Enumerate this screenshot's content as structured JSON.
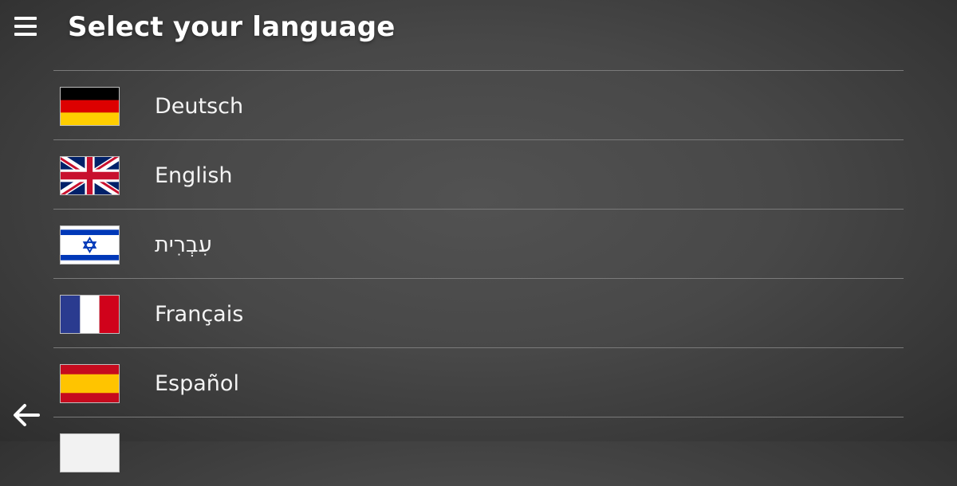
{
  "header": {
    "menu_icon": "hamburger-menu-icon",
    "title": "Select your language"
  },
  "languages": [
    {
      "label": "Deutsch",
      "flag": "flag-germany-icon"
    },
    {
      "label": "English",
      "flag": "flag-uk-icon"
    },
    {
      "label": "עִבְרִית",
      "flag": "flag-israel-icon"
    },
    {
      "label": "Français",
      "flag": "flag-france-icon"
    },
    {
      "label": "Español",
      "flag": "flag-spain-icon"
    },
    {
      "label": "",
      "flag": "flag-partially-visible-icon"
    }
  ],
  "footer": {
    "back_icon": "back-arrow-icon"
  },
  "colors": {
    "background": "#4a4a4a",
    "divider": "#7a7a7a",
    "text": "#ffffff"
  }
}
